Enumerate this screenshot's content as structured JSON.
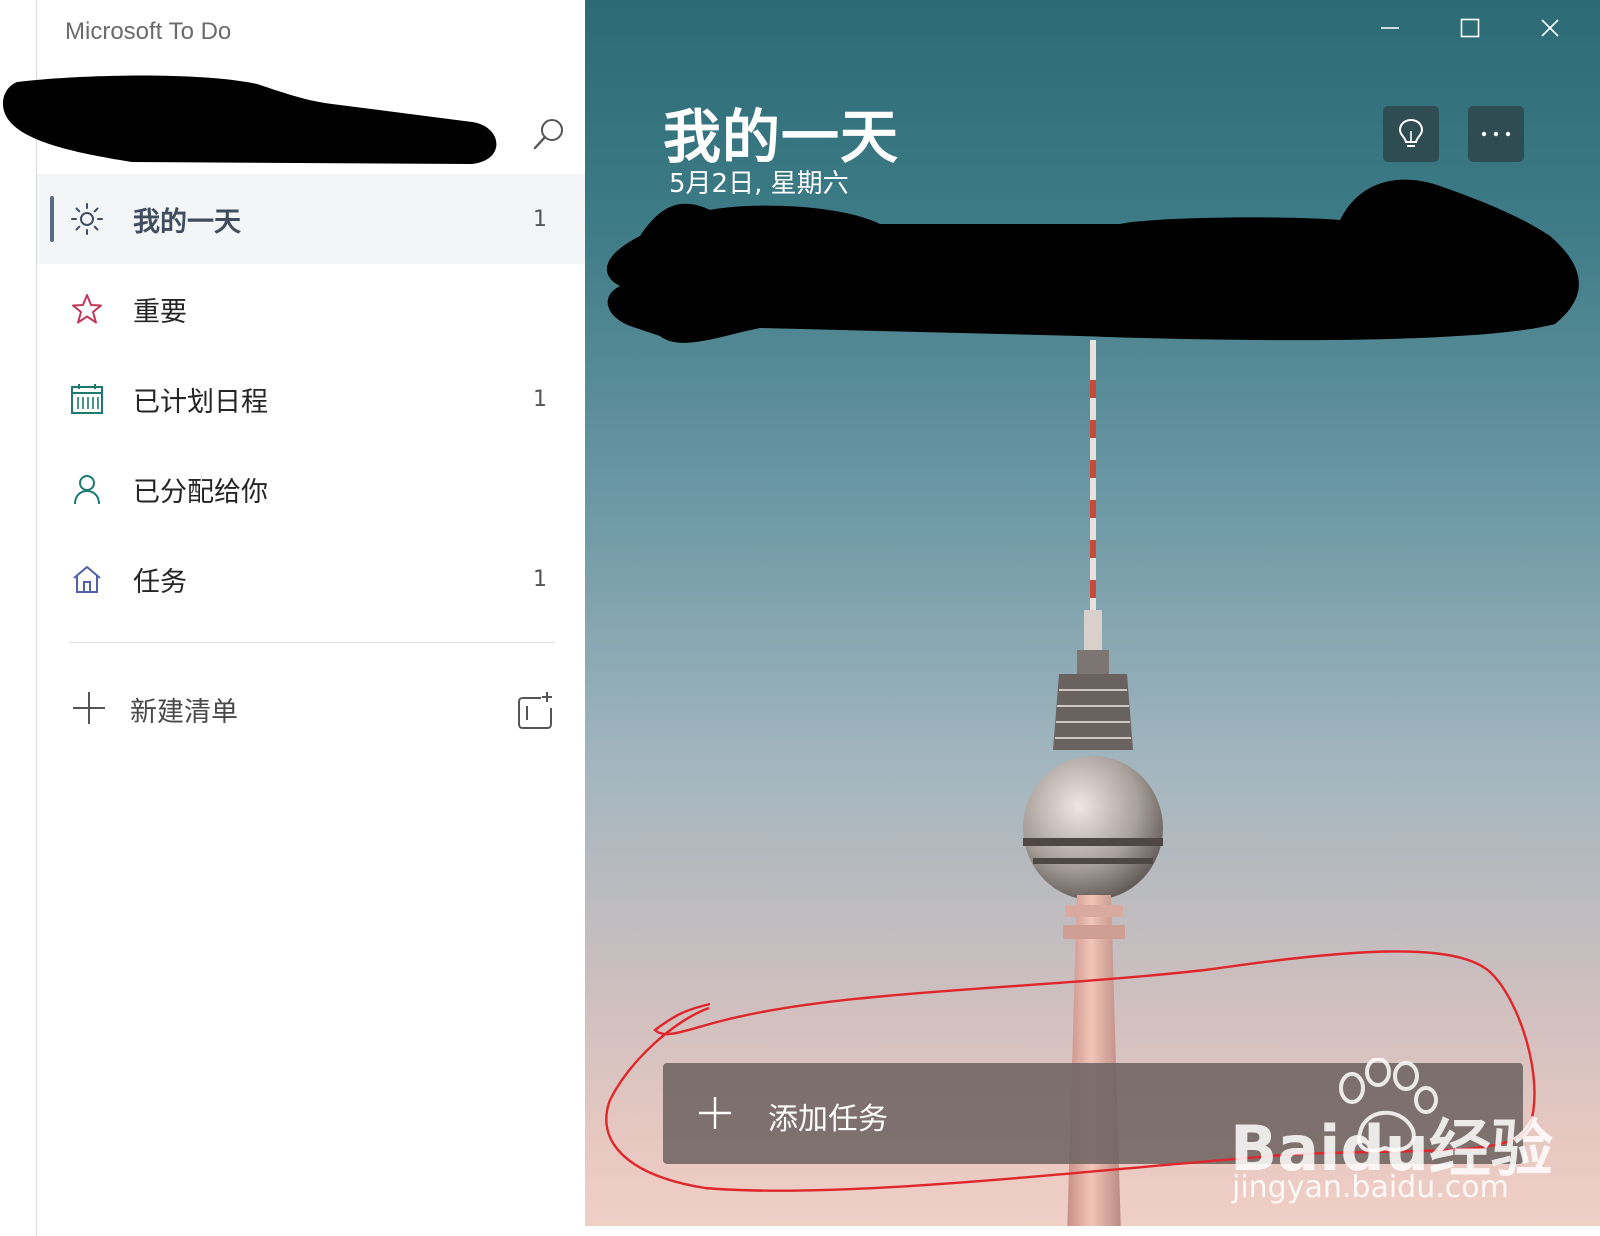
{
  "app": {
    "title": "Microsoft To Do"
  },
  "sidebar": {
    "items": [
      {
        "label": "我的一天",
        "count": "1",
        "icon": "sun-icon",
        "active": true
      },
      {
        "label": "重要",
        "count": "",
        "icon": "star-icon"
      },
      {
        "label": "已计划日程",
        "count": "1",
        "icon": "calendar-icon"
      },
      {
        "label": "已分配给你",
        "count": "",
        "icon": "person-icon"
      },
      {
        "label": "任务",
        "count": "1",
        "icon": "home-icon"
      }
    ],
    "new_list_label": "新建清单"
  },
  "main": {
    "title": "我的一天",
    "date": "5月2日, 星期六",
    "add_task_label": "添加任务"
  },
  "watermark": {
    "logo": "Baidu经验",
    "url": "jingyan.baidu.com"
  },
  "colors": {
    "accent": "#5a6b7f",
    "star": "#c0395a",
    "calendar": "#1c7a6e",
    "person": "#1c7a6e",
    "home": "#5160a8",
    "annotation": "#e0262a"
  }
}
